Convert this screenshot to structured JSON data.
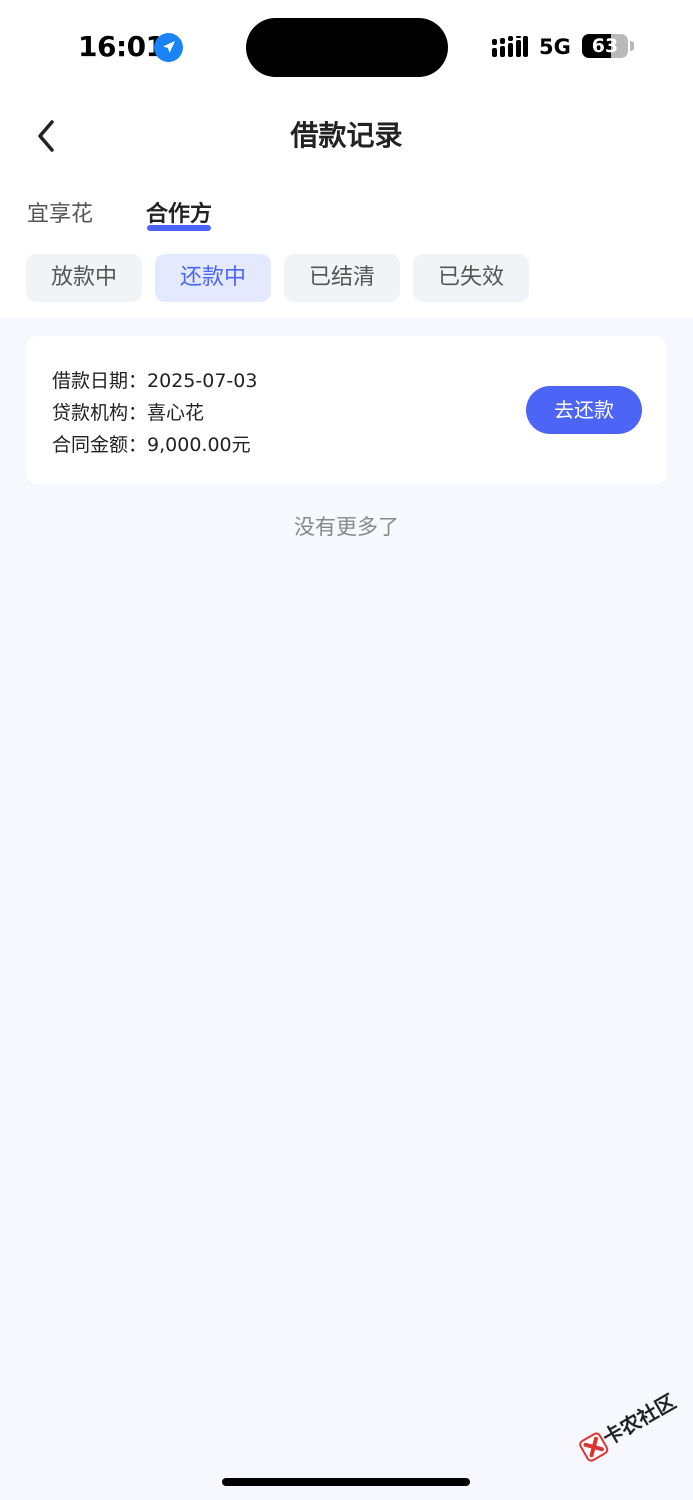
{
  "status_bar": {
    "time": "16:01",
    "network": "5G",
    "battery": "63",
    "battery_level": 0.63,
    "icons": [
      "location-arrow-icon",
      "signal-icon",
      "battery-icon"
    ]
  },
  "nav": {
    "title": "借款记录",
    "back_icon": "chevron-left-icon"
  },
  "tabs": [
    {
      "label": "宜享花",
      "active": false
    },
    {
      "label": "合作方",
      "active": true
    }
  ],
  "filters": [
    {
      "label": "放款中",
      "active": false
    },
    {
      "label": "还款中",
      "active": true
    },
    {
      "label": "已结清",
      "active": false
    },
    {
      "label": "已失效",
      "active": false
    }
  ],
  "records": [
    {
      "date_label": "借款日期：",
      "date": "2025-07-03",
      "org_label": "贷款机构：",
      "org": "喜心花",
      "amount_label": "合同金额：",
      "amount": "9,000.00元",
      "action": "去还款"
    }
  ],
  "footer": {
    "no_more": "没有更多了"
  },
  "watermark": {
    "text": "卡农社区"
  },
  "colors": {
    "accent": "#4d65f6",
    "chip_active_bg": "#e4e9fd",
    "page_bg": "#f6f8fd"
  }
}
